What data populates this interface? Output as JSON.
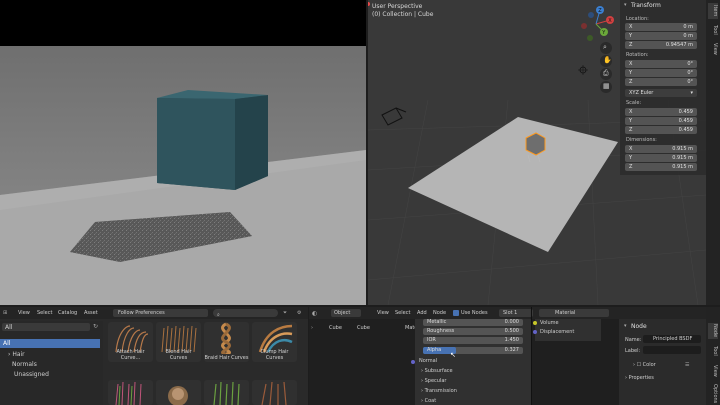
{
  "render": {},
  "viewport": {
    "header": {
      "view_name": "User Perspective",
      "collection": "(0) Collection | Cube"
    },
    "npanel": {
      "title": "Transform",
      "location_label": "Location:",
      "location": [
        {
          "axis": "X",
          "value": "0 m"
        },
        {
          "axis": "Y",
          "value": "0 m"
        },
        {
          "axis": "Z",
          "value": "0.94547 m"
        }
      ],
      "rotation_label": "Rotation:",
      "rotation": [
        {
          "axis": "X",
          "value": "0°"
        },
        {
          "axis": "Y",
          "value": "0°"
        },
        {
          "axis": "Z",
          "value": "0°"
        }
      ],
      "rotation_mode": "XYZ Euler",
      "scale_label": "Scale:",
      "scale": [
        {
          "axis": "X",
          "value": "0.459"
        },
        {
          "axis": "Y",
          "value": "0.459"
        },
        {
          "axis": "Z",
          "value": "0.459"
        }
      ],
      "dimensions_label": "Dimensions:",
      "dimensions": [
        {
          "axis": "X",
          "value": "0.915 m"
        },
        {
          "axis": "Y",
          "value": "0.915 m"
        },
        {
          "axis": "Z",
          "value": "0.915 m"
        }
      ]
    },
    "tabs": [
      "Item",
      "Tool",
      "View"
    ],
    "gizmo": {
      "x": "X",
      "y": "Y",
      "z": "Z"
    }
  },
  "assets": {
    "menu": [
      "View",
      "Select",
      "Catalog",
      "Asset"
    ],
    "import": "Follow Preferences",
    "search_placeholder": "",
    "filter": "All",
    "tree": [
      "All",
      "Hair",
      "Normals",
      "Unassigned"
    ],
    "thumbs": [
      {
        "label": "Attach Hair Curve...",
        "color": "#b7794a"
      },
      {
        "label": "Blend Hair Curves",
        "color": "#a9713f"
      },
      {
        "label": "Braid Hair Curves",
        "color": "#c58a4c"
      },
      {
        "label": "Clump Hair Curves",
        "color": "#b97b41"
      },
      {
        "label": "",
        "color": "#c0557a"
      },
      {
        "label": "",
        "color": "#8b6b4a"
      },
      {
        "label": "",
        "color": "#6aa040"
      },
      {
        "label": "",
        "color": "#9a5b3a"
      }
    ]
  },
  "nodes": {
    "menu": [
      "Object",
      "View",
      "Select",
      "Add",
      "Node"
    ],
    "use_nodes": "Use Nodes",
    "slot": "Slot 1",
    "material": "Material",
    "breadcrumb": [
      "Cube",
      "Cube",
      "Material"
    ],
    "rows": [
      {
        "label": "Metallic",
        "value": "0.000"
      },
      {
        "label": "Roughness",
        "value": "0.500"
      },
      {
        "label": "IOR",
        "value": "1.450"
      },
      {
        "label": "Alpha",
        "value": "0.327"
      }
    ],
    "sections": [
      "Normal",
      "Subsurface",
      "Specular",
      "Transmission",
      "Coat"
    ],
    "output_sockets": [
      "Volume",
      "Displacement"
    ]
  },
  "props": {
    "title": "Node",
    "name_label": "Name:",
    "name_value": "Principled BSDF",
    "label_label": "Label:",
    "color_label": "Color",
    "properties_label": "Properties",
    "tabs": [
      "Node",
      "Tool",
      "View",
      "Options"
    ]
  },
  "colors": {
    "accent": "#4772b3",
    "selection_outline": "#ff9a1f"
  }
}
